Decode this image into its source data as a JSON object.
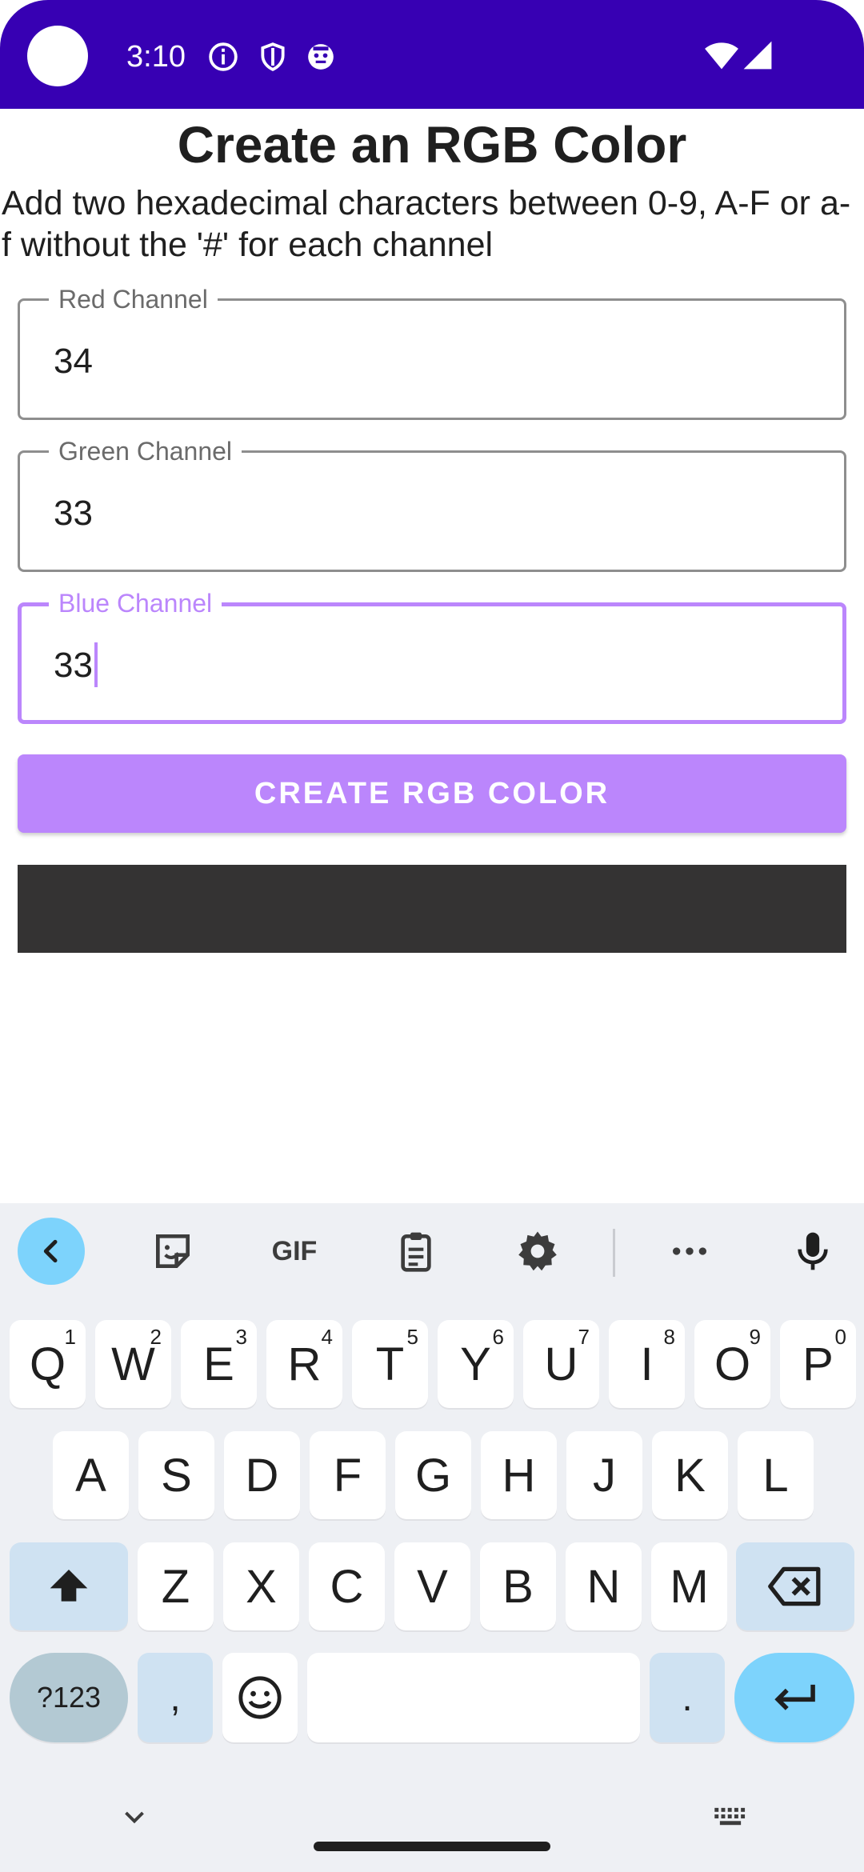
{
  "status_bar": {
    "time": "3:10",
    "background_color": "#3700b3",
    "icons": [
      "info-icon",
      "shield-icon",
      "robot-icon",
      "wifi-icon",
      "signal-icon"
    ]
  },
  "page": {
    "title": "Create an RGB Color",
    "subtitle": "Add two hexadecimal characters between 0-9, A-F or a-f without the '#' for each channel"
  },
  "fields": {
    "red": {
      "label": "Red Channel",
      "value": "34"
    },
    "green": {
      "label": "Green Channel",
      "value": "33"
    },
    "blue": {
      "label": "Blue Channel",
      "value": "33",
      "focused": true
    }
  },
  "create_button": {
    "label": "CREATE RGB COLOR",
    "color": "#bb86fc"
  },
  "color_preview": {
    "color": "#343333"
  },
  "keyboard": {
    "toolbar": [
      "back-icon",
      "sticker-icon",
      "GIF",
      "clipboard-icon",
      "settings-icon",
      "more-icon",
      "mic-icon"
    ],
    "gif_label": "GIF",
    "row1": [
      {
        "k": "Q",
        "h": "1"
      },
      {
        "k": "W",
        "h": "2"
      },
      {
        "k": "E",
        "h": "3"
      },
      {
        "k": "R",
        "h": "4"
      },
      {
        "k": "T",
        "h": "5"
      },
      {
        "k": "Y",
        "h": "6"
      },
      {
        "k": "U",
        "h": "7"
      },
      {
        "k": "I",
        "h": "8"
      },
      {
        "k": "O",
        "h": "9"
      },
      {
        "k": "P",
        "h": "0"
      }
    ],
    "row2": [
      "A",
      "S",
      "D",
      "F",
      "G",
      "H",
      "J",
      "K",
      "L"
    ],
    "row3": [
      "Z",
      "X",
      "C",
      "V",
      "B",
      "N",
      "M"
    ],
    "symbols_label": "?123",
    "comma": ",",
    "period": ".",
    "accent_color": "#7dd3fc"
  }
}
